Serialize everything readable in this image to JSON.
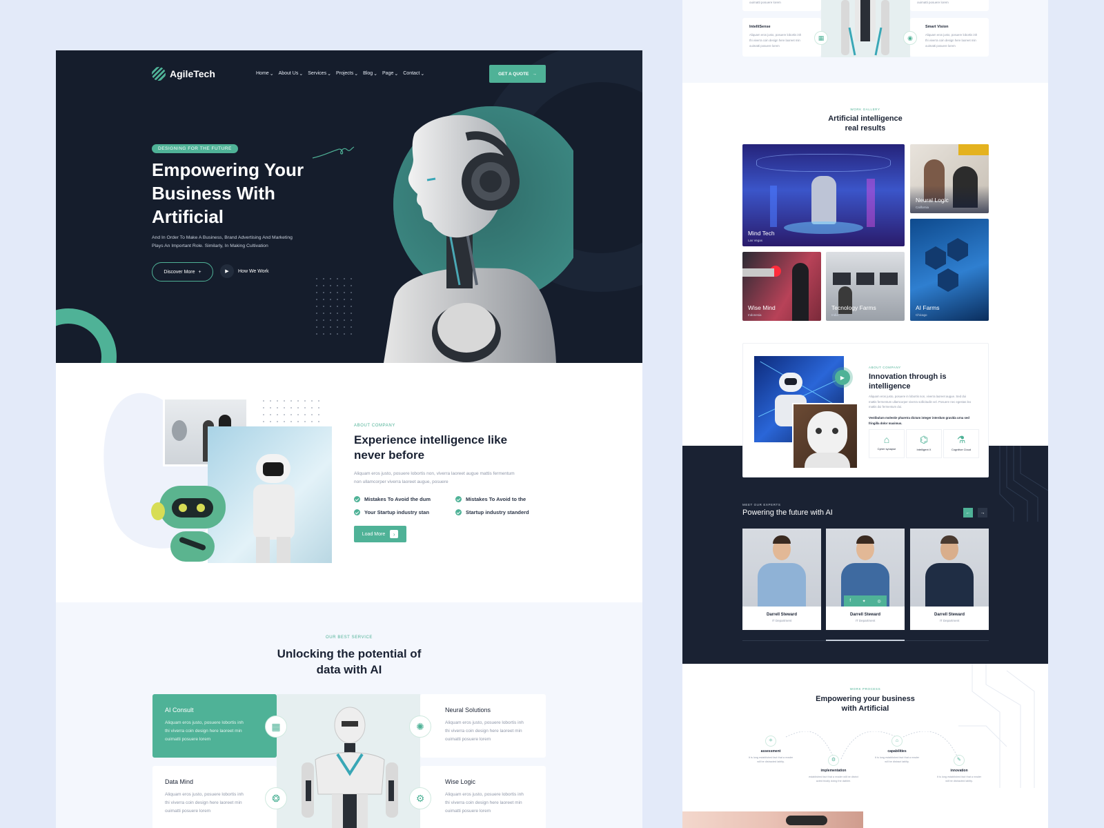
{
  "brand": {
    "name": "AgileTech"
  },
  "nav": {
    "items": [
      "Home",
      "About Us",
      "Services",
      "Projects",
      "Blog",
      "Page",
      "Contact"
    ],
    "cta": "GET A QUOTE"
  },
  "hero": {
    "badge": "DESIGNING FOR THE FUTURE",
    "title_l1": "Empowering Your",
    "title_l2": "Business With",
    "title_l3": "Artificial",
    "desc_l1": "And In Order To Make A Business, Brand Advertising And Marketing",
    "desc_l2": "Plays An Important Role. Similarly, In Making Cultivation",
    "discover": "Discover More",
    "how": "How We Work"
  },
  "about": {
    "eyebrow": "ABOUT COMPANY",
    "title_l1": "Experience intelligence like",
    "title_l2": "never before",
    "desc_l1": "Aliquam eros justo, posuere lobortis non, viverra laoreet augue mattis fermentum",
    "desc_l2": "non ullamcorper viverra laoreet augue, posuere",
    "checks": [
      "Mistakes To Avoid the dum",
      "Mistakes To Avoid to the",
      "Your Startup industry stan",
      "Startup industry standerd"
    ],
    "load_more": "Load More"
  },
  "services": {
    "eyebrow": "OUR BEST SERVICE",
    "title_l1": "Unlocking the potential of",
    "title_l2": "data with AI",
    "items": [
      {
        "name": "AI Consult",
        "l1": "Aliquam eros justo, posuere lobortis inh",
        "l2": "thi viverra coin design here laoreet min",
        "l3": "ouimatti  posuere  lorem"
      },
      {
        "name": "Neural Solutions",
        "l1": "Aliquam eros justo, posuere lobortis inh",
        "l2": "thi viverra coin design here laoreet min",
        "l3": "ouimatti  posuere  lorem"
      },
      {
        "name": "Data Mind",
        "l1": "Aliquam eros justo, posuere lobortis inh",
        "l2": "thi viverra coin design here laoreet min",
        "l3": "ouimatti  posuere  lorem"
      },
      {
        "name": "Wise Logic",
        "l1": "Aliquam eros justo, posuere lobortis inh",
        "l2": "thi viverra coin design here laoreet min",
        "l3": "ouimatti  posuere  lorem"
      }
    ]
  },
  "right_top": {
    "top_l": "ouimatti  posuere  lorem",
    "top_r": "ouimatti  posuere  lorem",
    "intellisense": "IntelliSense",
    "smartvision": "Smart Vision",
    "l1": "Aliquam eros justo, posuere lobortis inh",
    "l2": "thi viverra coin design here laoreet min",
    "l3": "ouimatti  posuere  lorem"
  },
  "gallery": {
    "eyebrow": "WORK GALLERY",
    "title_l1": "Artificial intelligence",
    "title_l2": "real results",
    "items": [
      {
        "name": "Mind Tech",
        "loc": "Las Vegas"
      },
      {
        "name": "Neural Logic",
        "loc": "California"
      },
      {
        "name": "Wise Mind",
        "loc": "Indonesia"
      },
      {
        "name": "Tecnology Farms",
        "loc": "India"
      },
      {
        "name": "AI Farms",
        "loc": "Chicago"
      }
    ]
  },
  "innovation": {
    "eyebrow": "ABOUT COMPANY",
    "title_l1": "Innovation through is",
    "title_l2": "intelligence",
    "d1": "Aliquam eros justo, posuere in lobortis non, viverra laoreet augue. Sed dui",
    "d2": "mattis fermentum ullamcorper viverra sollicitudin vel. Posuere nec egestas leo",
    "d3": "mattis dui fermentum dui.",
    "bold1": "Vestibulum molestie pharetra dictum integer interdum gravida urna sed",
    "bold2": "fringilla dolor maximus.",
    "features": [
      "Cyber synapse",
      "Intelligent X",
      "Cognitive Cloud"
    ]
  },
  "experts": {
    "eyebrow": "MEET OUR EXPERTS",
    "title": "Powering the future with AI",
    "members": [
      {
        "name": "Darrell Steward",
        "role": "IT Department"
      },
      {
        "name": "Darrell Steward",
        "role": "IT Department"
      },
      {
        "name": "Darrell Steward",
        "role": "IT Department"
      }
    ]
  },
  "process": {
    "eyebrow": "WORK PROCESS",
    "title_l1": "Empowering your business",
    "title_l2": "with Artificial",
    "steps": [
      {
        "name": "assessment",
        "l1": "It is long established fact that a reader",
        "l2": "will be distracted lablity."
      },
      {
        "name": "implementation",
        "l1": "established fact that a reader will be distrct",
        "l2": "acted biodiy doing the dablee."
      },
      {
        "name": "capabilities",
        "l1": "It is long established fact that a reader",
        "l2": "will be distract lablity."
      },
      {
        "name": "innovation",
        "l1": "It is long established fact that a reader",
        "l2": "will be distracted lablity."
      }
    ]
  },
  "colors": {
    "accent": "#4fb297",
    "dark": "#151d2c",
    "bg": "#e3eaf9"
  }
}
